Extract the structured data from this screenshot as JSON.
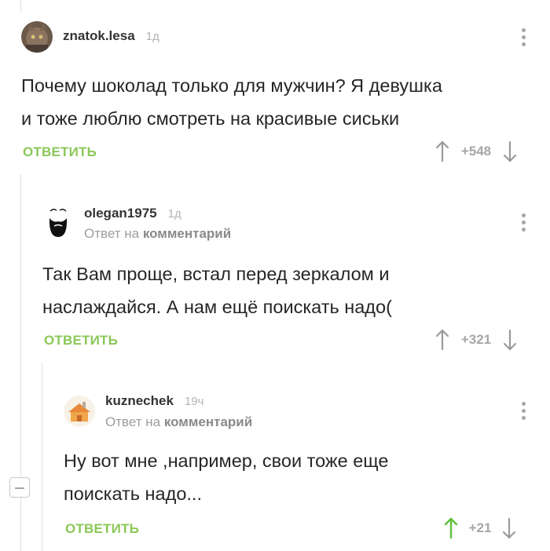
{
  "comments": [
    {
      "username": "znatok.lesa",
      "time": "1д",
      "text_lines": [
        "Почему шоколад только для мужчин? Я девушка",
        "и тоже люблю смотреть на красивые сиськи"
      ],
      "reply_label": "ОТВЕТИТЬ",
      "score": "+548"
    },
    {
      "username": "olegan1975",
      "time": "1д",
      "reply_prefix": "Ответ на",
      "reply_target": "комментарий",
      "text_lines": [
        "Так Вам проще, встал перед зеркалом и",
        "наслаждайся. А нам ещё поискать надо("
      ],
      "reply_label": "ОТВЕТИТЬ",
      "score": "+321"
    },
    {
      "username": "kuznechek",
      "time": "19ч",
      "reply_prefix": "Ответ на",
      "reply_target": "комментарий",
      "text_lines": [
        "Ну вот мне ,например, свои тоже еще",
        "поискать надо..."
      ],
      "reply_label": "ОТВЕТИТЬ",
      "score": "+21"
    }
  ],
  "colors": {
    "accent_green": "#8ac858",
    "muted_gray": "#a6a6a6",
    "upvoted_green": "#5fbf3c"
  },
  "icons": {
    "upvote": "arrow-up-icon",
    "downvote": "arrow-down-icon",
    "menu": "more-vertical-icon",
    "collapse": "minus-square-icon"
  }
}
